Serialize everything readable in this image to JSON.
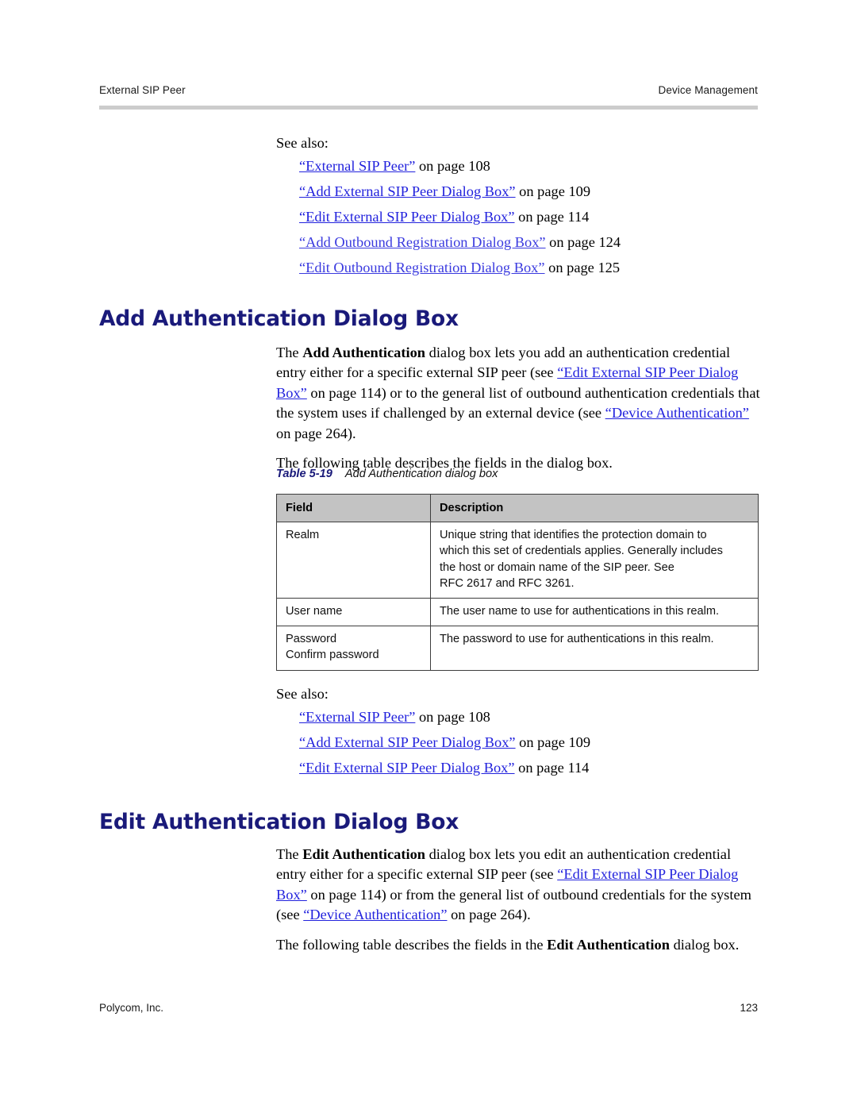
{
  "running_head": {
    "left": "External SIP Peer",
    "right": "Device Management"
  },
  "footer": {
    "left": "Polycom, Inc.",
    "page_number": "123"
  },
  "colors": {
    "heading": "#1a1a7a",
    "link": "#2222dd",
    "table_header_bg": "#c3c3c3",
    "rule": "#cccccc"
  },
  "see_also_1": {
    "label": "See also:",
    "items": [
      {
        "title": "“External SIP Peer”",
        "suffix": " on page 108"
      },
      {
        "title": "“Add External SIP Peer Dialog Box”",
        "suffix": " on page 109"
      },
      {
        "title": "“Edit External SIP Peer Dialog Box”",
        "suffix": " on page 114"
      },
      {
        "title": "“Add Outbound Registration Dialog Box”",
        "suffix": " on page 124"
      },
      {
        "title": "“Edit Outbound Registration Dialog Box”",
        "suffix": " on page 125"
      }
    ]
  },
  "section_add": {
    "heading": "Add Authentication Dialog Box",
    "para_1": {
      "t1": "The ",
      "bold1": "Add Authentication",
      "t2": " dialog box lets you add an authentication credential entry either for a specific external SIP peer (see ",
      "link1": "“Edit External SIP Peer Dialog Box”",
      "t3": " on page 114) or to the general list of outbound authentication credentials that the system uses if challenged by an external device (see ",
      "link2": "“Device Authentication”",
      "t4": " on page 264)."
    },
    "para_2": "The following table describes the fields in the dialog box.",
    "table_caption": {
      "number": "Table 5-19",
      "text": "Add Authentication dialog box"
    },
    "table": {
      "columns": [
        "Field",
        "Description"
      ],
      "rows": [
        {
          "field": [
            "Realm"
          ],
          "description": [
            "Unique string that identifies the protection domain to",
            "which this set of credentials applies. Generally includes",
            "the host or domain name of the SIP peer. See",
            "RFC 2617 and RFC 3261."
          ]
        },
        {
          "field": [
            "User name"
          ],
          "description": [
            "The user name to use for authentications in this realm."
          ]
        },
        {
          "field": [
            "Password",
            "Confirm password"
          ],
          "description": [
            "The password to use for authentications in this realm."
          ]
        }
      ]
    }
  },
  "see_also_2": {
    "label": "See also:",
    "items": [
      {
        "title": "“External SIP Peer”",
        "suffix": " on page 108"
      },
      {
        "title": "“Add External SIP Peer Dialog Box”",
        "suffix": " on page 109"
      },
      {
        "title": "“Edit External SIP Peer Dialog Box”",
        "suffix": " on page 114"
      }
    ]
  },
  "section_edit": {
    "heading": "Edit Authentication Dialog Box",
    "para_1": {
      "t1": "The ",
      "bold1": "Edit Authentication",
      "t2": " dialog box lets you edit an authentication credential entry either for a specific external SIP peer (see ",
      "link1": "“Edit External SIP Peer Dialog Box”",
      "t3": " on page 114) or from the general list of outbound credentials for the system (see ",
      "link2": "“Device Authentication”",
      "t4": " on page 264)."
    },
    "para_2": {
      "t1": "The following table describes the fields in the ",
      "bold1": "Edit Authentication",
      "t2": " dialog box."
    }
  }
}
